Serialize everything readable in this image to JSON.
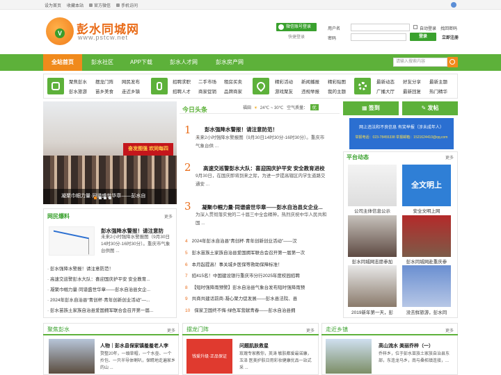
{
  "topbar": {
    "links": [
      "设为首页",
      "收藏本站",
      "官方微信",
      "手机访问"
    ]
  },
  "logo": {
    "title": "彭水同城网",
    "url": "www.pstcw.net"
  },
  "wechat": {
    "login": "微信账号登录",
    "quick": "快捷登录"
  },
  "login": {
    "username": "用户名",
    "password": "密码",
    "auto": "自动登录",
    "find": "找回密码",
    "login_btn": "登录",
    "register": "立即注册"
  },
  "nav": {
    "items": [
      "全站首页",
      "彭水社区",
      "APP下载",
      "彭水人才网",
      "彭水房产网"
    ],
    "search_placeholder": "请输入搜索内容"
  },
  "cats": {
    "g1": [
      "聚焦彭水",
      "摆龙门阵",
      "网民发布",
      "彭水旅游",
      "苗乡美食",
      "走近乡镇"
    ],
    "g2": [
      "招聘求职",
      "二手市场",
      "租房买卖",
      "招聘人才",
      "商家促销",
      "品牌商家"
    ],
    "g3": [
      "精彩活动",
      "新闻播报",
      "精彩贴图",
      "游戏聚友",
      "违规举报",
      "我的主题"
    ],
    "g4": [
      "最新动态",
      "好友分享",
      "最新主题",
      "广播大厅",
      "最新回复",
      "热门精华"
    ]
  },
  "banner": {
    "screen": "奋发图强 欢同每四",
    "caption": "凝聚巾帼力量·同谱盛世华章——彭水自"
  },
  "toutiao": {
    "title": "今日头条",
    "weather_city": "福田",
    "weather_temp": "24℃ ~ 30℃",
    "air_label": "空气质量：",
    "air": "优"
  },
  "headlines": [
    {
      "n": "1",
      "title": "彭水强降水警报！请注意防范！",
      "desc": "未来2小时强降水警报图（9月30日14时30分-16时30分）。重庆市气象台供 ..."
    },
    {
      "n": "2",
      "title": "高速交巡警彭水大队：喜迎国庆护平安 安全教育进校",
      "desc": "9月30日，在国庆即将到来之际，为进一步提高辖区内学生道路交通安 ..."
    },
    {
      "n": "3",
      "title": "凝聚巾帼力量·同谱盛世华章——彭水自治县女企业...",
      "desc": "为深入贯彻落实党的二十届三中全会精神，热烈庆祝中华人民共和国 ..."
    }
  ],
  "list": [
    {
      "n": "4",
      "t": "2024年彭水自治县“青创杯·青年创新创业活动”——汉"
    },
    {
      "n": "5",
      "t": "彭水苗族土家族自治县爱国拥军联合会召开第一届第一次"
    },
    {
      "n": "6",
      "t": "本月起提高！事关城乡医保等救助保障标准！"
    },
    {
      "n": "7",
      "t": "招415名！中国建设银行重庆市分行2025年度校园招聘"
    },
    {
      "n": "8",
      "t": "【短时强降雨预警】彭水自治县气象台发布短时强降雨预"
    },
    {
      "n": "9",
      "t": "共商共建话前商·凝心聚力促发展——彭水县法院、县"
    },
    {
      "n": "10",
      "t": "保家卫国终不悔·绿色军营献青春——彭水自治县拥"
    }
  ],
  "wangmin": {
    "title": "网民爆料",
    "more": "更多",
    "top_title": "彭水强降水警报！请注意防",
    "top_desc": "未来2小时强降水警报图（9月30日14时30分-16时30分）。重庆市气象台供图 ...",
    "items": [
      "彭水强降水警报！请注意防范！",
      "高速交巡警彭水大队：喜迎国庆护平安 安全教育...",
      "凝聚巾帼力量·同谱盛世华章——彭水自治县女企...",
      "2024年彭水自治县“青创杯·青年创新创业活动”—...",
      "彭水苗族土家族自治县爱国拥军联合会召开第一届..."
    ]
  },
  "right": {
    "sign": "签到",
    "post": "发帖",
    "notice_title": "网上违法和不良信息 有奖举报（涉未成年人）",
    "notice_sub": "举报电话：023-78455338  举报邮箱：1521624410@qq.com",
    "platform": "平台动态",
    "more": "更多",
    "thumbs": [
      "公司主体信息公示",
      "安全文明上网",
      "彭水同城网志愿参加",
      "彭水同城网赴重庆参",
      "2019新年第一天，彭",
      "没去鲜旅游，彭水同"
    ],
    "thumb_text": "全文明上"
  },
  "footer": [
    {
      "head": "聚焦彭水",
      "more": "更多",
      "title": "人物｜彭水县保家镇羞羞老人李",
      "desc": "赘整20年，一頭草帽，一个水壶、一个拎包、一只半导体喇叭，保睛地走遍家乡的山 ..."
    },
    {
      "head": "摆龙门阵",
      "more": "更多",
      "title": "问题肌肤救星",
      "desc": "玫瑰专家教你，英涛 敏肤都爱最诺康，玉泽 医美护肤日用彩妆健康优品一站式采 ...",
      "img": "钱爱升级·正品保证"
    },
    {
      "head": "走近乡镇",
      "more": "更多",
      "title": "高山流水 美丽乔梓（一）",
      "desc": "乔梓乡，位于彭水苗族土家族自治县东部，东连龙马乡，南与桑柘镇连接，..."
    }
  ]
}
